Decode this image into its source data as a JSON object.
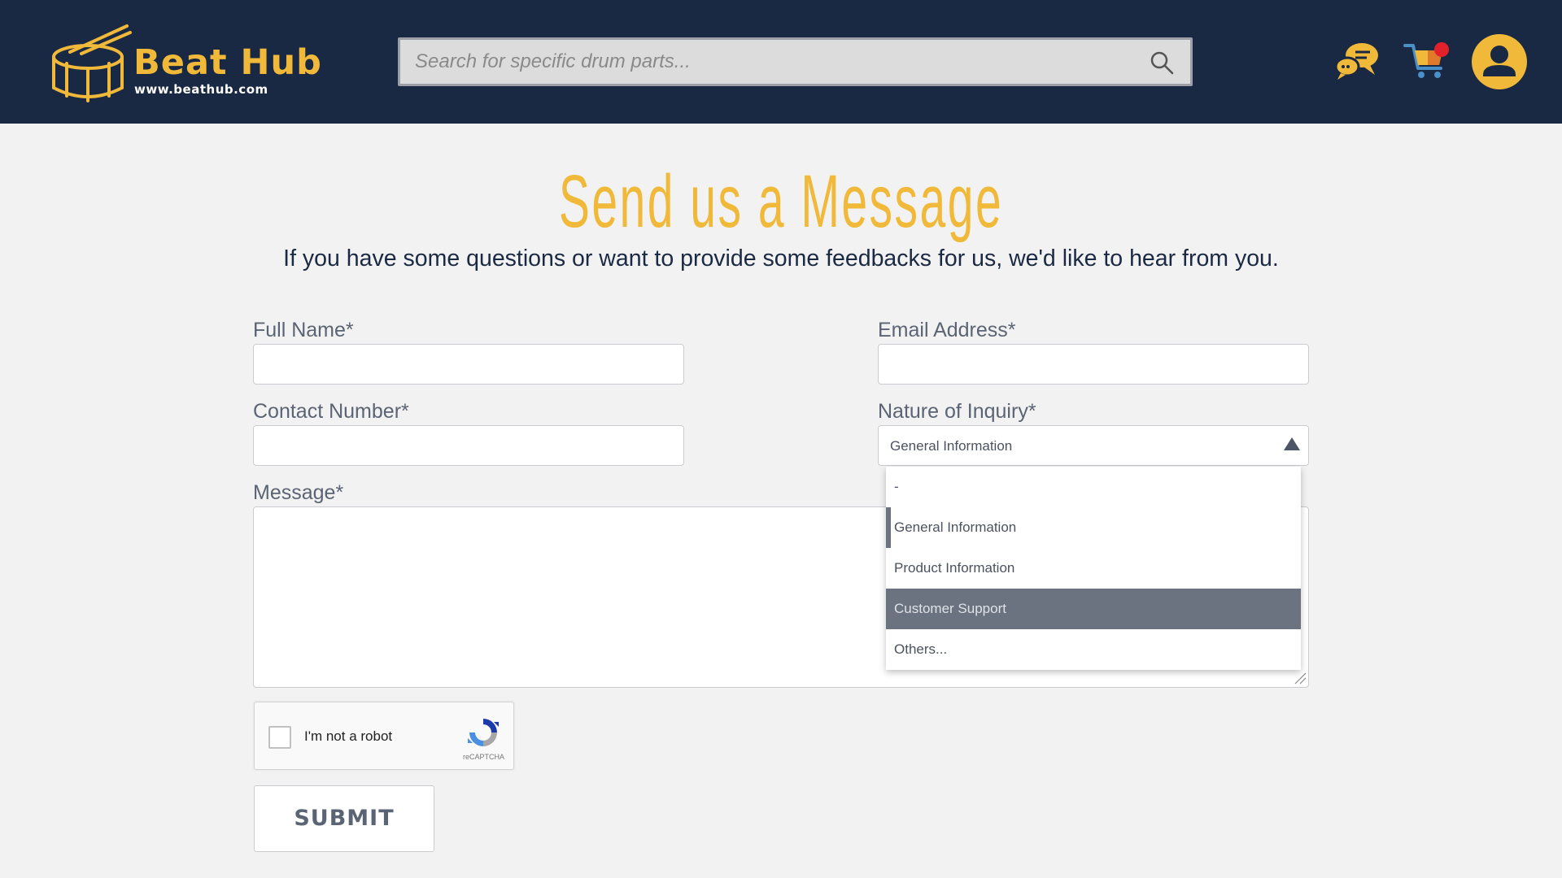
{
  "brand": {
    "name": "Beat Hub",
    "url": "www.beathub.com",
    "accent_color": "#f0b93a",
    "header_color": "#192843"
  },
  "header": {
    "search_placeholder": "Search for specific drum parts...",
    "icons": [
      "search-icon",
      "chat-icon",
      "cart-icon",
      "user-icon"
    ],
    "cart_notification_color": "#e3212b"
  },
  "page": {
    "title": "Send us a Message",
    "subtitle": "If you have some questions or want to provide some feedbacks for us, we'd like to hear from you."
  },
  "form": {
    "full_name_label": "Full Name*",
    "full_name_value": "",
    "email_label": "Email Address*",
    "email_value": "",
    "contact_label": "Contact Number*",
    "contact_value": "",
    "inquiry_label": "Nature of Inquiry*",
    "inquiry_selected": "General Information",
    "inquiry_options": [
      "-",
      "General Information",
      "Product Information",
      "Customer Support",
      "Others..."
    ],
    "inquiry_hovered": "Customer Support",
    "message_label": "Message*",
    "message_value": "",
    "captcha_label": "I'm not a robot",
    "captcha_brand": "reCAPTCHA",
    "submit_label": "SUBMIT"
  }
}
